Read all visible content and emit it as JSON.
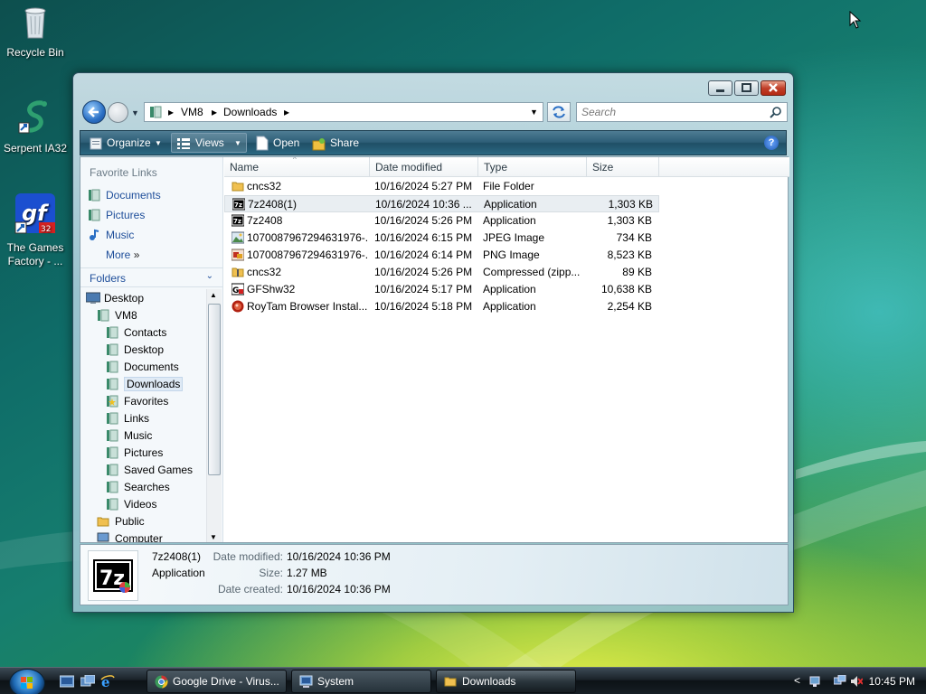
{
  "desktop": {
    "icons": [
      {
        "label": "Recycle Bin",
        "icon": "recycle-bin-icon"
      },
      {
        "label": "Serpent IA32",
        "icon": "serpent-icon"
      },
      {
        "label": "The Games Factory - ...",
        "icon": "games-factory-icon"
      }
    ]
  },
  "window": {
    "address": {
      "crumbs": [
        "VM8",
        "Downloads"
      ]
    },
    "search_placeholder": "Search",
    "toolbar": {
      "organize": "Organize",
      "views": "Views",
      "open": "Open",
      "share": "Share",
      "help": "?"
    },
    "favorite_links": {
      "title": "Favorite Links",
      "items": [
        "Documents",
        "Pictures",
        "Music"
      ],
      "more": "More",
      "more_arrow": "»"
    },
    "folders": {
      "title": "Folders",
      "tree": [
        {
          "label": "Desktop",
          "level": 0
        },
        {
          "label": "VM8",
          "level": 1
        },
        {
          "label": "Contacts",
          "level": 2
        },
        {
          "label": "Desktop",
          "level": 2
        },
        {
          "label": "Documents",
          "level": 2
        },
        {
          "label": "Downloads",
          "level": 2,
          "selected": true
        },
        {
          "label": "Favorites",
          "level": 2
        },
        {
          "label": "Links",
          "level": 2
        },
        {
          "label": "Music",
          "level": 2
        },
        {
          "label": "Pictures",
          "level": 2
        },
        {
          "label": "Saved Games",
          "level": 2
        },
        {
          "label": "Searches",
          "level": 2
        },
        {
          "label": "Videos",
          "level": 2
        },
        {
          "label": "Public",
          "level": 1
        },
        {
          "label": "Computer",
          "level": 1
        }
      ]
    },
    "columns": [
      "Name",
      "Date modified",
      "Type",
      "Size"
    ],
    "files": [
      {
        "name": "cncs32",
        "date": "10/16/2024 5:27 PM",
        "type": "File Folder",
        "size": "",
        "icon": "folder-icon"
      },
      {
        "name": "7z2408(1)",
        "date": "10/16/2024 10:36 ...",
        "type": "Application",
        "size": "1,303 KB",
        "icon": "7zip-icon",
        "selected": true
      },
      {
        "name": "7z2408",
        "date": "10/16/2024 5:26 PM",
        "type": "Application",
        "size": "1,303 KB",
        "icon": "7zip-icon"
      },
      {
        "name": "1070087967294631976-...",
        "date": "10/16/2024 6:15 PM",
        "type": "JPEG Image",
        "size": "734 KB",
        "icon": "jpeg-icon"
      },
      {
        "name": "1070087967294631976-...",
        "date": "10/16/2024 6:14 PM",
        "type": "PNG Image",
        "size": "8,523 KB",
        "icon": "png-icon"
      },
      {
        "name": "cncs32",
        "date": "10/16/2024 5:26 PM",
        "type": "Compressed (zipp...",
        "size": "89 KB",
        "icon": "zip-folder-icon"
      },
      {
        "name": "GFShw32",
        "date": "10/16/2024 5:17 PM",
        "type": "Application",
        "size": "10,638 KB",
        "icon": "gf-app-icon"
      },
      {
        "name": "RoyTam Browser Instal...",
        "date": "10/16/2024 5:18 PM",
        "type": "Application",
        "size": "2,254 KB",
        "icon": "roytam-icon"
      }
    ],
    "details": {
      "name": "7z2408(1)",
      "type": "Application",
      "modified_label": "Date modified:",
      "modified": "10/16/2024 10:36 PM",
      "size_label": "Size:",
      "size": "1.27 MB",
      "created_label": "Date created:",
      "created": "10/16/2024 10:36 PM"
    }
  },
  "taskbar": {
    "tasks": [
      {
        "label": "Google Drive - Virus...",
        "icon": "chrome-icon"
      },
      {
        "label": "System",
        "icon": "system-icon"
      },
      {
        "label": "Downloads",
        "icon": "folder-icon",
        "active": true
      }
    ],
    "tray_arrow": "<",
    "clock": "10:45 PM"
  }
}
